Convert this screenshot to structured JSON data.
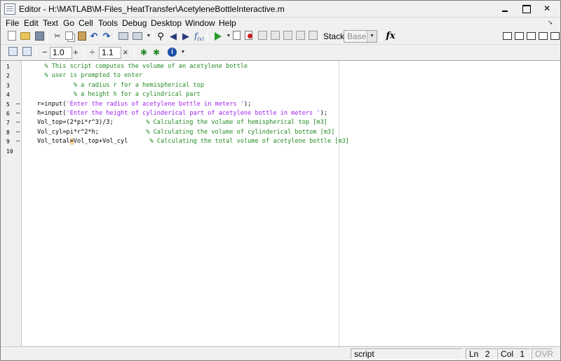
{
  "window": {
    "title": "Editor - H:\\MATLAB\\M-Files_HeatTransfer\\AcetyleneBottleInteractive.m",
    "icons": [
      "minimize-icon",
      "maximize-icon",
      "close-icon"
    ]
  },
  "menu": [
    "File",
    "Edit",
    "Text",
    "Go",
    "Cell",
    "Tools",
    "Debug",
    "Desktop",
    "Window",
    "Help"
  ],
  "toolbar": {
    "stack_label": "Stack:",
    "stack_value": "Base",
    "fx_label": "fx"
  },
  "cell_toolbar": {
    "minus": "−",
    "first_value": "1.0",
    "plus": "+",
    "divide": "÷",
    "second_value": "1.1",
    "times": "×"
  },
  "editor": {
    "lines": [
      {
        "num": "1",
        "dash": "",
        "segments": [
          {
            "t": "  % This script computes the volume of an acetylene bottle",
            "c": "cmt"
          }
        ]
      },
      {
        "num": "2",
        "dash": "",
        "segments": [
          {
            "t": "  % user is prompted to enter",
            "c": "cmt"
          }
        ]
      },
      {
        "num": "3",
        "dash": "",
        "segments": [
          {
            "t": "          % a radius r for a hemispherical top",
            "c": "cmt"
          }
        ]
      },
      {
        "num": "4",
        "dash": "",
        "segments": [
          {
            "t": "          % a height h for a cylindrical part",
            "c": "cmt"
          }
        ]
      },
      {
        "num": "5",
        "dash": "–",
        "segments": [
          {
            "t": "r=input(",
            "c": ""
          },
          {
            "t": "'Enter the radius of acetylene bottle in meters '",
            "c": "str"
          },
          {
            "t": ");",
            "c": ""
          }
        ]
      },
      {
        "num": "6",
        "dash": "–",
        "segments": [
          {
            "t": "h=input(",
            "c": ""
          },
          {
            "t": "'Enter the height of cylinderical part of acetylene bottle in meters '",
            "c": "str"
          },
          {
            "t": ");",
            "c": ""
          }
        ]
      },
      {
        "num": "7",
        "dash": "–",
        "segments": [
          {
            "t": "Vol_top=(2*pi*r^3)/3;         ",
            "c": ""
          },
          {
            "t": "% Calculating the volume of hemispherical top [m3]",
            "c": "cmt"
          }
        ]
      },
      {
        "num": "8",
        "dash": "–",
        "segments": [
          {
            "t": "Vol_cyl=pi*r^2*h;             ",
            "c": ""
          },
          {
            "t": "% Calculating the volume of cylinderical bottom [m3]",
            "c": "cmt"
          }
        ]
      },
      {
        "num": "9",
        "dash": "–",
        "segments": [
          {
            "t": "Vol_total",
            "c": ""
          },
          {
            "t": "=",
            "c": "cursor"
          },
          {
            "t": "Vol_top+Vol_cyl      ",
            "c": ""
          },
          {
            "t": "% Calculating the total volume of acetylene bottle [m3]",
            "c": "cmt"
          }
        ]
      },
      {
        "num": "10",
        "dash": "",
        "segments": []
      }
    ]
  },
  "status": {
    "mode": "script",
    "line_label": "Ln",
    "line_value": "2",
    "col_label": "Col",
    "col_value": "1",
    "ovr": "OVR"
  }
}
